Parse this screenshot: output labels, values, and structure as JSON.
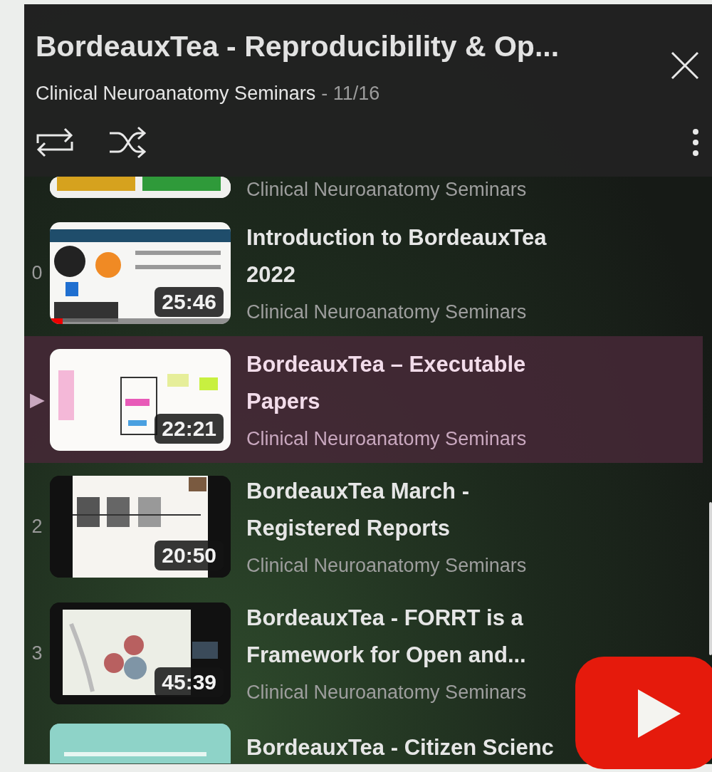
{
  "header": {
    "title": "BordeauxTea - Reproducibility & Op...",
    "channel": "Clinical Neuroanatomy Seminars",
    "position": "- 11/16"
  },
  "rows": [
    {
      "kind": "partial",
      "channel": "Clinical Neuroanatomy Seminars",
      "selected": false
    },
    {
      "kind": "full",
      "index": "0",
      "title": "Introduction to BordeauxTea 2022",
      "duration": "25:46",
      "channel": "Clinical Neuroanatomy Seminars",
      "selected": false,
      "progress": {
        "level": 0.07
      }
    },
    {
      "kind": "full",
      "title": "BordeauxTea – Executable Papers",
      "duration": "22:21",
      "channel": "Clinical Neuroanatomy Seminars",
      "selected": true,
      "marker": "▶"
    },
    {
      "kind": "full",
      "index": "2",
      "title": "BordeauxTea March - Registered Reports",
      "duration": "20:50",
      "channel": "Clinical Neuroanatomy Seminars",
      "selected": false
    },
    {
      "kind": "full",
      "index": "3",
      "title": "BordeauxTea - FORRT is a Framework for Open and...",
      "duration": "45:39",
      "channel": "Clinical Neuroanatomy Seminars",
      "selected": false
    },
    {
      "kind": "cut",
      "title": "BordeauxTea - Citizen Scienc",
      "selected": false
    }
  ]
}
